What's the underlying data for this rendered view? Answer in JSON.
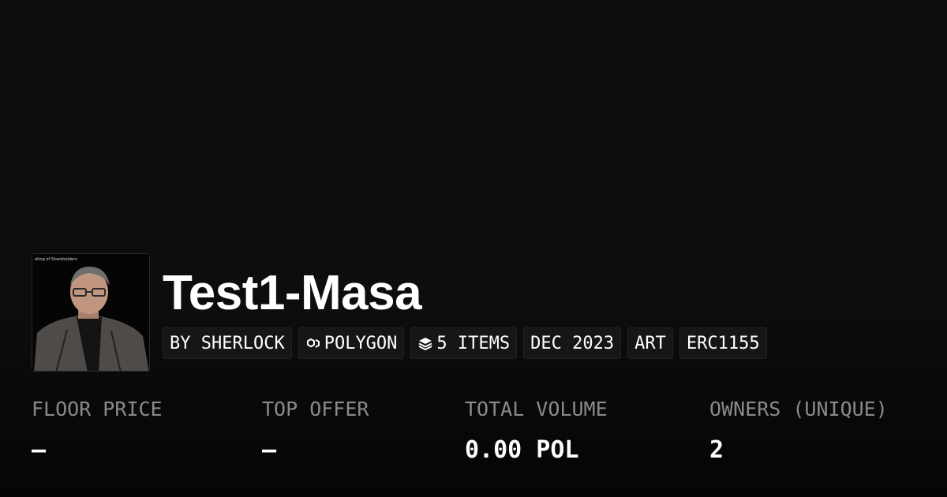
{
  "collection": {
    "image_caption": "eting of Shareholders",
    "title": "Test1-Masa"
  },
  "tags": {
    "creator": "BY SHERLOCK",
    "chain": "POLYGON",
    "chain_icon": "polygon-icon",
    "items": "5 ITEMS",
    "items_icon": "layers-icon",
    "date": "DEC 2023",
    "category": "ART",
    "standard": "ERC1155"
  },
  "stats": {
    "floor_price_label": "FLOOR PRICE",
    "floor_price_value": "–",
    "top_offer_label": "TOP OFFER",
    "top_offer_value": "–",
    "total_volume_label": "TOTAL VOLUME",
    "total_volume_value": "0.00 POL",
    "owners_label": "OWNERS (UNIQUE)",
    "owners_value": "2"
  },
  "colors": {
    "background": "#0d0d0d",
    "label_gray": "#8a8a8a",
    "tag_background": "#161616",
    "text": "#ffffff"
  }
}
